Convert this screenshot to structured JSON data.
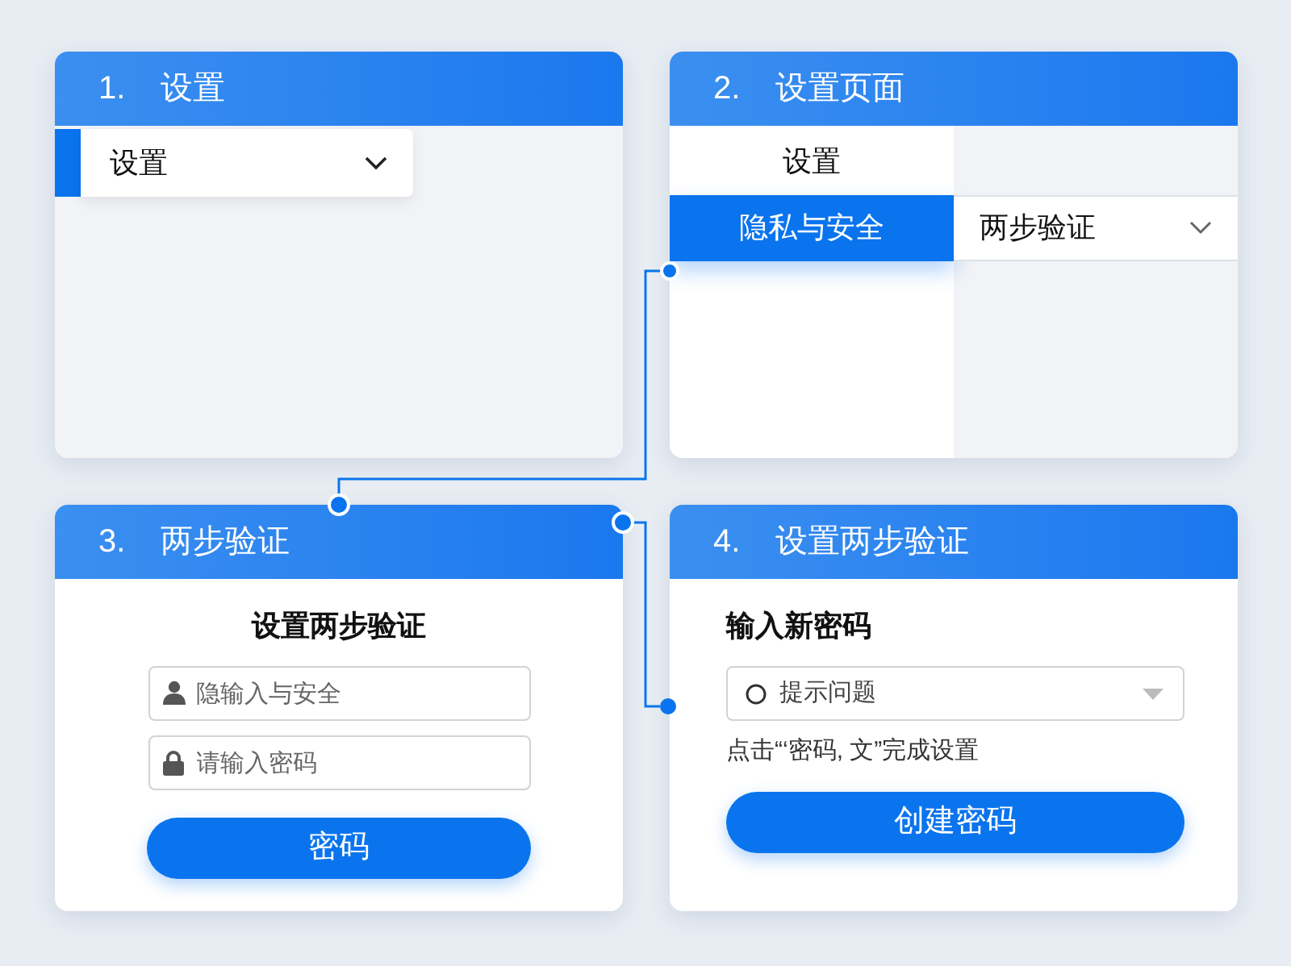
{
  "steps": [
    {
      "number": "1.",
      "title": "设置",
      "kind": "menu",
      "dropdown": {
        "label": "设置"
      }
    },
    {
      "number": "2.",
      "title": "设置页面",
      "kind": "settings",
      "menu_items": [
        {
          "label": "设置",
          "selected": false
        },
        {
          "label": "隐私与安全",
          "selected": true
        }
      ],
      "dropdown": {
        "label": "两步验证"
      }
    },
    {
      "number": "3.",
      "title": "两步验证",
      "kind": "login",
      "heading": "设置两步验证",
      "fields": [
        {
          "placeholder": "隐输入与安全"
        },
        {
          "placeholder": "请输入密码"
        }
      ],
      "button": "密码"
    },
    {
      "number": "4.",
      "title": "设置两步验证",
      "kind": "password",
      "heading": "输入新密码",
      "select": {
        "placeholder": "提示问题"
      },
      "hint": "点击“‘密码, 文”完成设置",
      "button": "创建密码"
    }
  ]
}
